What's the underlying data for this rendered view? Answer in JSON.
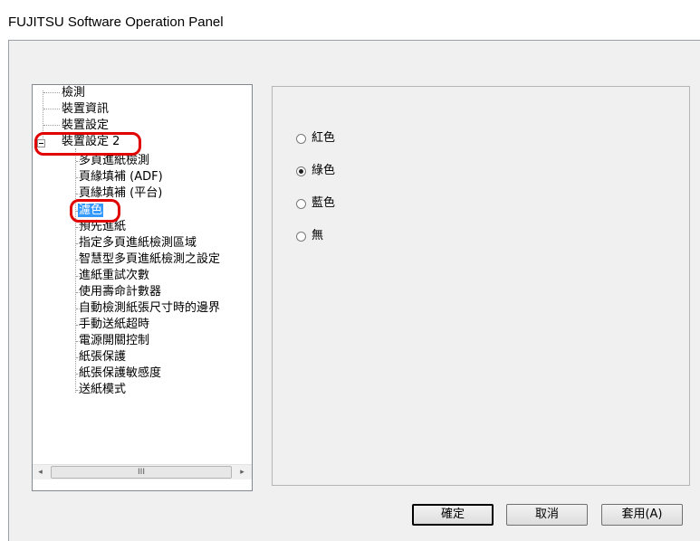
{
  "window": {
    "title": "FUJITSU Software Operation Panel"
  },
  "tree": {
    "items": [
      {
        "label": "檢測",
        "level": 0
      },
      {
        "label": "裝置資訊",
        "level": 0
      },
      {
        "label": "裝置設定",
        "level": 0
      },
      {
        "label": "裝置設定 2",
        "level": 0,
        "expanded": true
      },
      {
        "label": "多頁進紙檢測",
        "level": 1
      },
      {
        "label": "頁緣填補 (ADF)",
        "level": 1
      },
      {
        "label": "頁緣填補 (平台)",
        "level": 1
      },
      {
        "label": "濾色",
        "level": 1,
        "selected": true
      },
      {
        "label": "預先進紙",
        "level": 1
      },
      {
        "label": "指定多頁進紙檢測區域",
        "level": 1
      },
      {
        "label": "智慧型多頁進紙檢測之設定",
        "level": 1
      },
      {
        "label": "進紙重試次數",
        "level": 1
      },
      {
        "label": "使用壽命計數器",
        "level": 1
      },
      {
        "label": "自動檢測紙張尺寸時的邊界",
        "level": 1
      },
      {
        "label": "手動送紙超時",
        "level": 1
      },
      {
        "label": "電源開關控制",
        "level": 1
      },
      {
        "label": "紙張保護",
        "level": 1
      },
      {
        "label": "紙張保護敏感度",
        "level": 1
      },
      {
        "label": "送紙模式",
        "level": 1
      }
    ],
    "scrollbar": {
      "left_arrow": "◂",
      "thumb_grip": "III",
      "right_arrow": "▸"
    }
  },
  "color_dropout": {
    "options": [
      {
        "label": "紅色",
        "checked": false
      },
      {
        "label": "綠色",
        "checked": true
      },
      {
        "label": "藍色",
        "checked": false
      },
      {
        "label": "無",
        "checked": false
      }
    ]
  },
  "buttons": {
    "ok": "確定",
    "cancel": "取消",
    "apply": "套用(A)"
  },
  "colors": {
    "selection": "#3399ff",
    "annotation": "#e00000",
    "dialog_bg": "#f0f0f0"
  }
}
